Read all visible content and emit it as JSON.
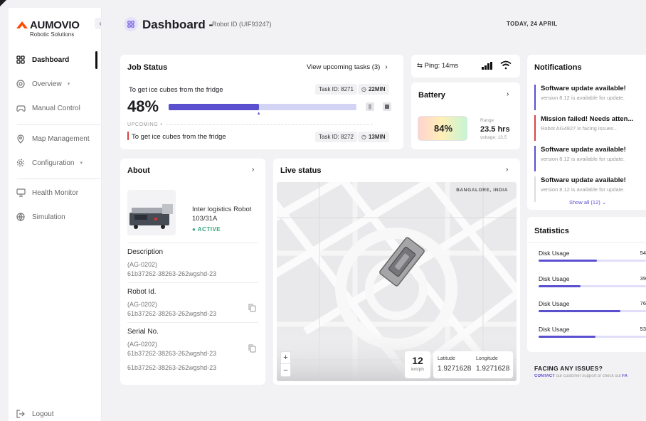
{
  "brand": {
    "name": "AUMOVIO",
    "tagline": "Robotic Solutions",
    "accent": "#ff4a00",
    "primary": "#5a4fcf"
  },
  "sidebar": {
    "collapse_icon": "chevron-left-icon",
    "items": [
      {
        "label": "Dashboard",
        "icon": "grid-icon",
        "active": true
      },
      {
        "label": "Overview",
        "icon": "overview-icon",
        "has_submenu": true
      },
      {
        "label": "Manual Control",
        "icon": "gamepad-icon"
      },
      {
        "label": "Map Management",
        "icon": "map-pin-icon"
      },
      {
        "label": "Configuration",
        "icon": "gear-icon",
        "has_submenu": true
      },
      {
        "label": "Health Monitor",
        "icon": "monitor-icon"
      },
      {
        "label": "Simulation",
        "icon": "simulation-icon"
      }
    ],
    "logout": "Logout"
  },
  "header": {
    "title": "Dashboard -",
    "robot_id": "Robot ID (UIF93247)",
    "date": "TODAY, 24 APRIL"
  },
  "job_status": {
    "title": "Job Status",
    "upcoming_link": "View upcoming tasks (3)",
    "current": {
      "name": "To get ice cubes from the fridge",
      "task_id": "Task ID: 8271",
      "eta": "22MIN",
      "progress_label": "48%",
      "progress": 0.48
    },
    "upcoming_label": "UPCOMING",
    "next": {
      "name": "To get ice cubes from the fridge",
      "task_id": "Task ID: 8272",
      "eta": "13MIN"
    }
  },
  "connection": {
    "ping": "Ping: 14ms"
  },
  "battery": {
    "title": "Battery",
    "percent_label": "84%",
    "percent": 0.84,
    "range_label": "Range",
    "range": "23.5 hrs",
    "voltage": "voltage: 13.5"
  },
  "about": {
    "title": "About",
    "robot_name": "Inter logistics Robot 103/31A",
    "status": "ACTIVE",
    "fields": [
      {
        "label": "Description",
        "value1": "(AG-0202)",
        "value2": "61b37262-38263-262wgshd-23",
        "copy": false
      },
      {
        "label": "Robot Id.",
        "value1": "(AG-0202)",
        "value2": "61b37262-38263-262wgshd-23",
        "copy": true
      },
      {
        "label": "Serial No.",
        "value1": "(AG-0202)",
        "value2": "61b37262-38263-262wgshd-23",
        "copy": true
      }
    ],
    "extra": "61b37262-38263-262wgshd-23"
  },
  "live_status": {
    "title": "Live status",
    "location": "BANGALORE, INDIA",
    "speed": "12",
    "speed_unit": "km/ph",
    "latitude_label": "Latitude",
    "latitude": "1.9271628",
    "longitude_label": "Longitude",
    "longitude": "1.9271628",
    "zoom_in": "+",
    "zoom_out": "−"
  },
  "notifications": {
    "title": "Notifications",
    "items": [
      {
        "title": "Software update available!",
        "desc": "version 8.12 is available for update.",
        "type": "info"
      },
      {
        "title": "Mission failed! Needs atten...",
        "desc": "Robot AG4827 is facing issues...",
        "type": "error"
      },
      {
        "title": "Software update available!",
        "desc": "version 8.12 is available for update.",
        "type": "info"
      },
      {
        "title": "Software update available!",
        "desc": "version 8.12 is available for update.",
        "type": "info"
      }
    ],
    "show_all": "Show all (12)"
  },
  "statistics": {
    "title": "Statistics",
    "rows": [
      {
        "label": "Disk Usage",
        "value": "54",
        "fill": 0.54
      },
      {
        "label": "Disk Usage",
        "value": "39",
        "fill": 0.39
      },
      {
        "label": "Disk Usage",
        "value": "76",
        "fill": 0.76
      },
      {
        "label": "Disk Usage",
        "value": "53",
        "fill": 0.53
      }
    ]
  },
  "issues": {
    "title": "FACING ANY ISSUES?",
    "contact": "CONTACT",
    "text": "our customer support or check out",
    "faq": "FA"
  }
}
